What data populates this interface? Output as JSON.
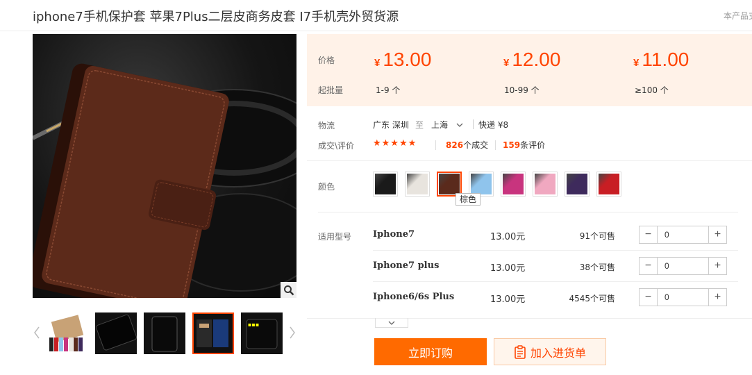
{
  "product": {
    "title": "iphone7手机保护套 苹果7Plus二层皮商务皮套 I7手机壳外贸货源",
    "report_text": "本产品支"
  },
  "price_panel": {
    "price_label": "价格",
    "moq_label": "起批量",
    "currency": "¥",
    "tiers": [
      {
        "price": "13.00",
        "range": "1-9 个"
      },
      {
        "price": "12.00",
        "range": "10-99 个"
      },
      {
        "price": "11.00",
        "range": "≥100 个"
      }
    ]
  },
  "logistics": {
    "label": "物流",
    "from": "广东 深圳",
    "to_word": "至",
    "to": "上海",
    "method": "快递 ¥8"
  },
  "reviews": {
    "label": "成交\\评价",
    "rating": 5,
    "stars_text": "★★★★★",
    "deals_count": "826",
    "deals_suffix": "个成交",
    "review_count": "159",
    "review_suffix": "条评价"
  },
  "colors": {
    "label": "颜色",
    "selected_index": 2,
    "tooltip": "棕色",
    "swatches": [
      {
        "name": "black",
        "color": "#1a1a1a"
      },
      {
        "name": "white",
        "color": "#e8e4de"
      },
      {
        "name": "brown",
        "color": "#5a2a1c"
      },
      {
        "name": "light-blue",
        "color": "#8fc4ec"
      },
      {
        "name": "magenta",
        "color": "#c8347e"
      },
      {
        "name": "pink",
        "color": "#f0a8c0"
      },
      {
        "name": "purple",
        "color": "#3e2a5c"
      },
      {
        "name": "red",
        "color": "#c81e24"
      }
    ]
  },
  "models": {
    "label": "适用型号",
    "items": [
      {
        "name": "Iphone7",
        "price": "13.00元",
        "stock": "91个可售",
        "qty": "0"
      },
      {
        "name": "Iphone7 plus",
        "price": "13.00元",
        "stock": "38个可售",
        "qty": "0"
      },
      {
        "name": "Iphone6/6s Plus",
        "price": "13.00元",
        "stock": "4545个可售",
        "qty": "0"
      }
    ]
  },
  "actions": {
    "buy_label": "立即订购",
    "cart_label": "加入进货单"
  },
  "colors_theme": {
    "accent": "#ff6a00",
    "price_red": "#ff4400",
    "panel_bg": "#fff2e8"
  }
}
